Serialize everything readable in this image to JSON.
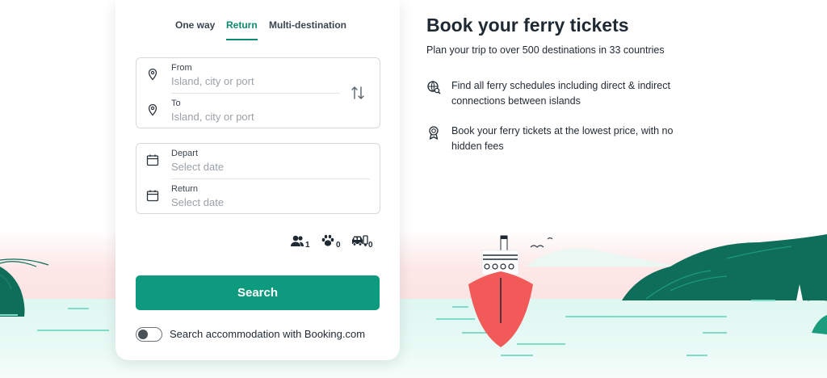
{
  "tabs": [
    {
      "label": "One way",
      "active": false
    },
    {
      "label": "Return",
      "active": true
    },
    {
      "label": "Multi-destination",
      "active": false
    }
  ],
  "route": {
    "from_label": "From",
    "from_placeholder": "Island, city or port",
    "to_label": "To",
    "to_placeholder": "Island, city or port"
  },
  "dates": {
    "depart_label": "Depart",
    "depart_placeholder": "Select date",
    "return_label": "Return",
    "return_placeholder": "Select date"
  },
  "travellers": {
    "passengers": "1",
    "pets": "0",
    "vehicles": "0"
  },
  "search_label": "Search",
  "accommodation_toggle": {
    "label": "Search accommodation with Booking.com",
    "on": false
  },
  "hero": {
    "title": "Book your ferry tickets",
    "subtitle": "Plan your trip to over 500 destinations in 33 countries",
    "features": [
      {
        "icon": "globe-search-icon",
        "text": "Find all ferry schedules including direct & indirect connections between islands"
      },
      {
        "icon": "award-ribbon-icon",
        "text": "Book your ferry tickets at the lowest price, with no hidden fees"
      }
    ]
  },
  "colors": {
    "accent": "#0e9a7e",
    "tab_active": "#0e8a73",
    "ferry_hull": "#f25a5a",
    "island": "#0f6e5a"
  }
}
